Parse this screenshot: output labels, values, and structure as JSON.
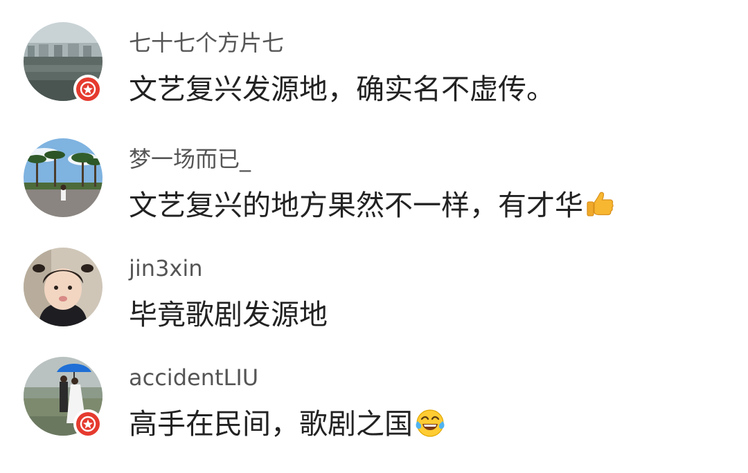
{
  "comments": [
    {
      "username": "七十七个方片七",
      "text": "文艺复兴发源地，确实名不虚传。",
      "avatar": "landscape-avatar",
      "verified_badge": true
    },
    {
      "username": "梦一场而已_",
      "text": "文艺复兴的地方果然不一样，有才华",
      "emoji": "thumbs-up-icon",
      "avatar": "palm-trees-avatar",
      "verified_badge": false
    },
    {
      "username": "jin3xin",
      "text": "毕竟歌剧发源地",
      "avatar": "child-avatar",
      "verified_badge": false
    },
    {
      "username": "accidentLIU",
      "text": "高手在民间，歌剧之国",
      "emoji": "laughing-crying-icon",
      "avatar": "umbrella-couple-avatar",
      "verified_badge": true
    }
  ],
  "colors": {
    "badge": "#e53b2f",
    "username": "#555555",
    "text": "#222222"
  }
}
